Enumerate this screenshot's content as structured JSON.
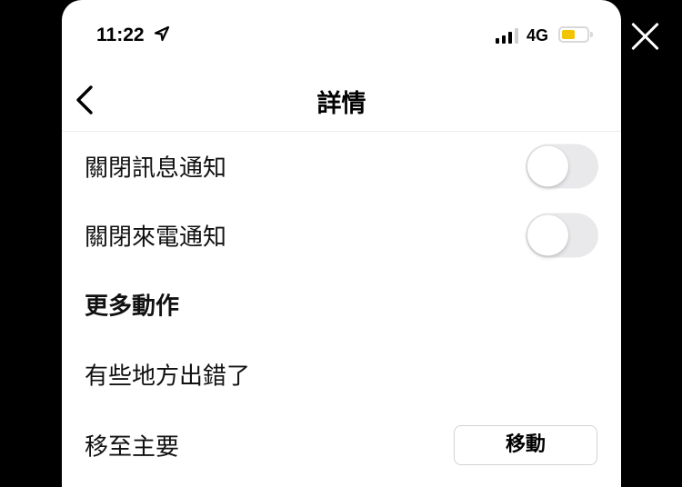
{
  "status_bar": {
    "time": "11:22",
    "network": "4G",
    "location_icon": "location-arrow-icon",
    "signal_icon": "cellular-signal-icon",
    "battery_icon": "battery-icon",
    "battery_color": "#f2c500"
  },
  "overlay": {
    "close_icon": "close-x-icon"
  },
  "nav": {
    "title": "詳情",
    "back_icon": "chevron-left-icon"
  },
  "settings": {
    "mute_messages": {
      "label": "關閉訊息通知",
      "enabled": false
    },
    "mute_calls": {
      "label": "關閉來電通知",
      "enabled": false
    }
  },
  "more_actions": {
    "header": "更多動作",
    "report_problem": "有些地方出錯了",
    "move_to_primary": {
      "label": "移至主要",
      "button": "移動"
    }
  }
}
